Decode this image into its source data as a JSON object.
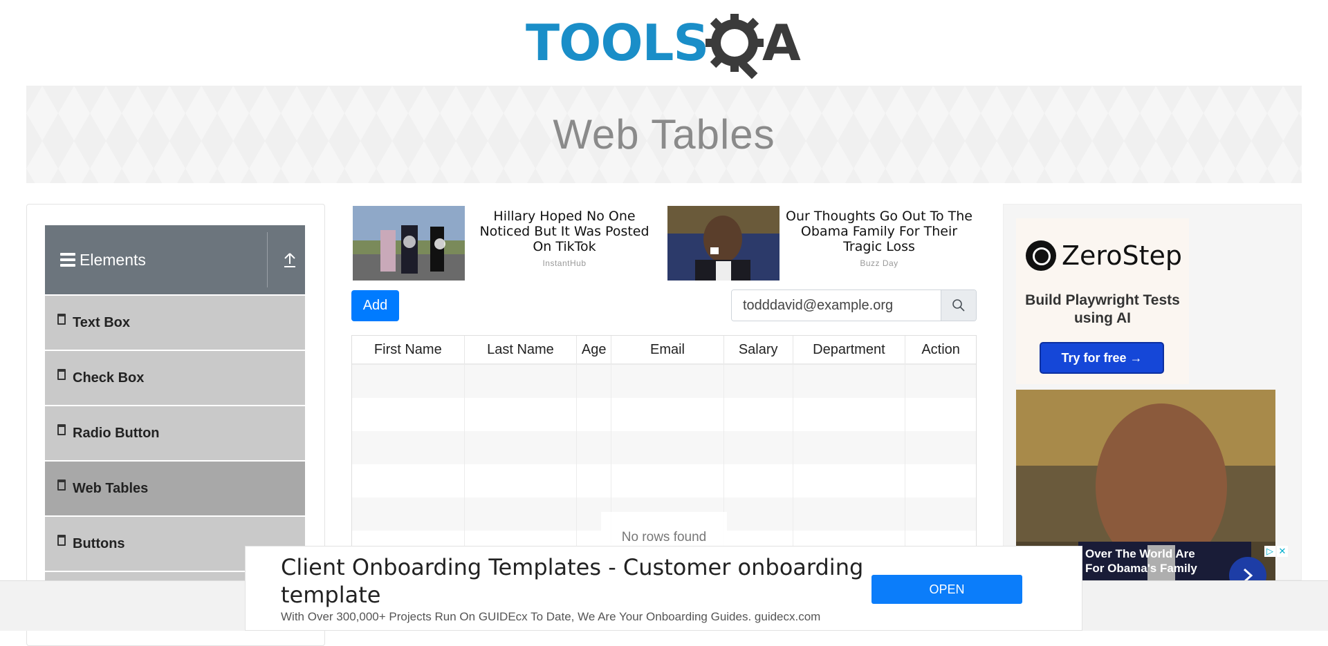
{
  "header": {
    "logo_text_left": "TOOLS",
    "logo_text_right": "A",
    "page_title": "Web Tables"
  },
  "sidebar": {
    "group_label": "Elements",
    "items": [
      {
        "label": "Text Box",
        "active": false
      },
      {
        "label": "Check Box",
        "active": false
      },
      {
        "label": "Radio Button",
        "active": false
      },
      {
        "label": "Web Tables",
        "active": true
      },
      {
        "label": "Buttons",
        "active": false
      }
    ]
  },
  "ads": [
    {
      "title": "Hillary Hoped No One Noticed But It Was Posted On TikTok",
      "source": "InstantHub"
    },
    {
      "title": "Our Thoughts Go Out To The Obama Family For Their Tragic Loss",
      "source": "Buzz Day"
    }
  ],
  "controls": {
    "add_label": "Add",
    "search_value": "todddavid@example.org"
  },
  "table": {
    "columns": [
      "First Name",
      "Last Name",
      "Age",
      "Email",
      "Salary",
      "Department",
      "Action"
    ],
    "empty_text": "No rows found"
  },
  "right_ad": {
    "brand": "ZeroStep",
    "subtitle": "Build Playwright Tests using AI",
    "cta": "Try for free →",
    "caption_line1": "Over The World Are",
    "caption_line2": "For Obama's Family"
  },
  "bottom_ad": {
    "title": "Client Onboarding Templates - Customer onboarding template",
    "description": "With Over 300,000+ Projects Run On GUIDEcx To Date, We Are Your Onboarding Guides. guidecx.com",
    "button": "OPEN"
  },
  "colors": {
    "primary": "#007bff",
    "sidebar_header": "#6c757d",
    "logo_blue": "#1a8ec8"
  }
}
